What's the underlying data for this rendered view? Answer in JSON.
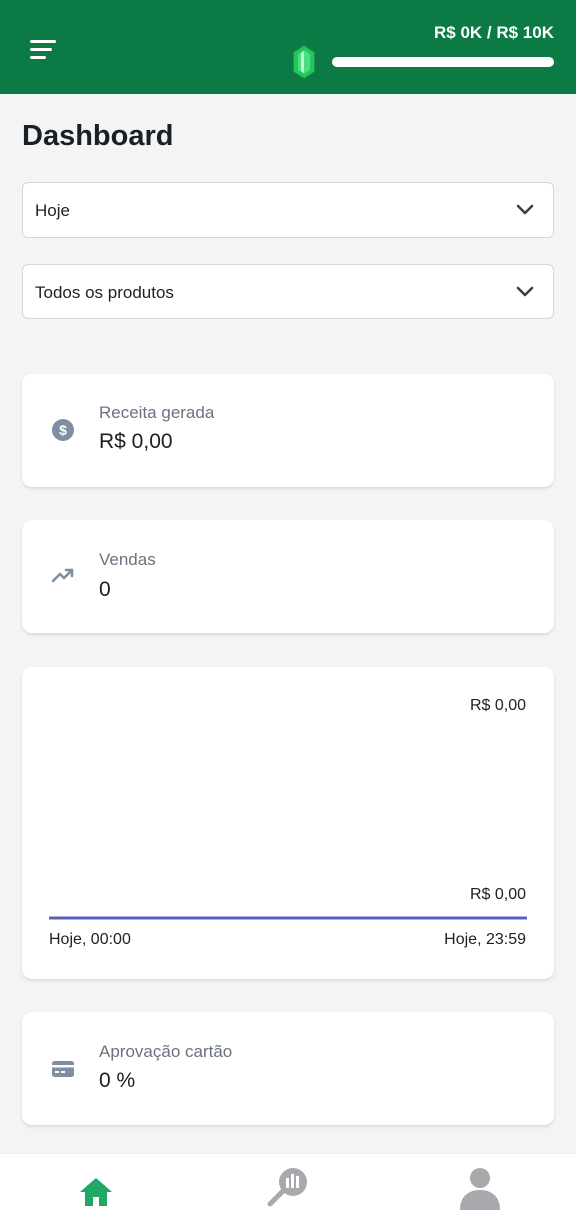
{
  "header": {
    "goal_text": "R$ 0K / R$ 10K",
    "goal_progress": 0,
    "accent_color": "#0b7a45",
    "icons": [
      "menu-icon",
      "gem-icon"
    ]
  },
  "page": {
    "title": "Dashboard"
  },
  "filters": {
    "period": "Hoje",
    "product": "Todos os produtos"
  },
  "cards": {
    "revenue": {
      "icon": "dollar-coin-icon",
      "label": "Receita gerada",
      "value": "R$ 0,00"
    },
    "sales": {
      "icon": "trending-up-icon",
      "label": "Vendas",
      "value": "0"
    },
    "approval": {
      "icon": "credit-card-icon",
      "label": "Aprovação cartão",
      "value": "0 %"
    }
  },
  "chart_data": {
    "type": "line",
    "x": [
      "Hoje, 00:00",
      "Hoje, 23:59"
    ],
    "series": [
      {
        "values": [
          0,
          0
        ]
      }
    ],
    "y_tick_labels": [
      "R$ 0,00",
      "R$ 0,00"
    ],
    "x_tick_labels": [
      "Hoje, 00:00",
      "Hoje, 23:59"
    ],
    "ylim": [
      0,
      0
    ],
    "line_color": "#5b5fb8",
    "grid": false
  },
  "bottom_nav": {
    "items": [
      {
        "icon": "home-icon",
        "active": true
      },
      {
        "icon": "analytics-search-icon",
        "active": false
      },
      {
        "icon": "user-icon",
        "active": false
      }
    ]
  }
}
